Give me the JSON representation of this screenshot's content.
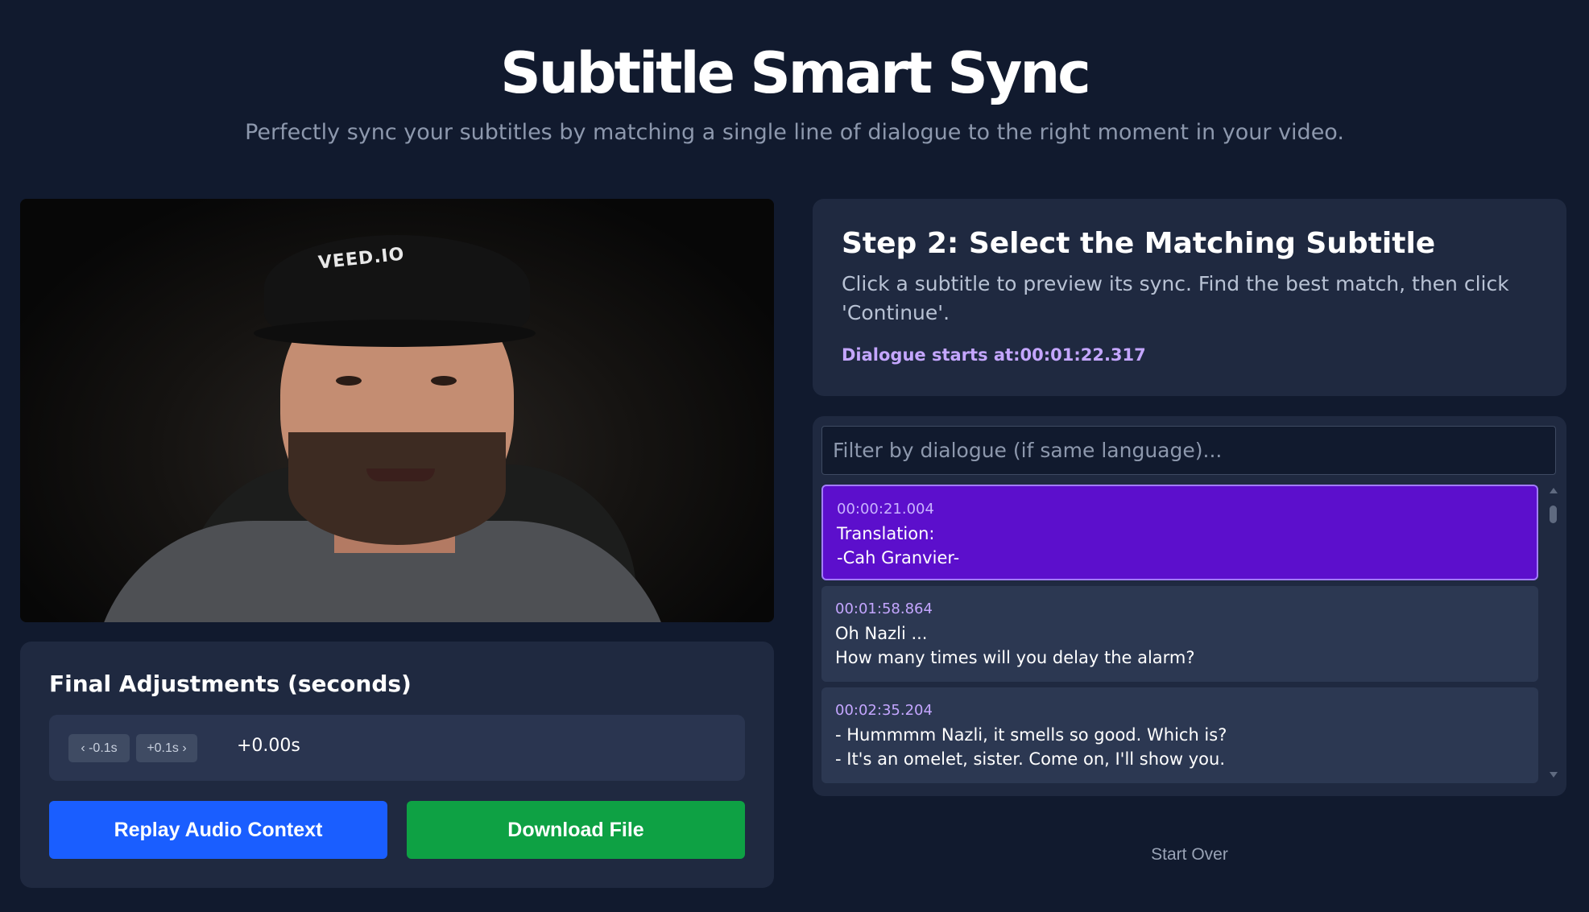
{
  "header": {
    "title": "Subtitle Smart Sync",
    "subtitle": "Perfectly sync your subtitles by matching a single line of dialogue to the right moment in your video."
  },
  "video": {
    "cap_logo": "VEED.IO"
  },
  "adjustments": {
    "title": "Final Adjustments (seconds)",
    "minus_label": "‹ -0.1s",
    "plus_label": "+0.1s ›",
    "offset_value": "+0.00s",
    "replay_label": "Replay Audio Context",
    "download_label": "Download File"
  },
  "step": {
    "title": "Step 2: Select the Matching Subtitle",
    "description": "Click a subtitle to preview its sync. Find the best match, then click 'Continue'.",
    "dialogue_start": "Dialogue starts at:00:01:22.317"
  },
  "filter": {
    "placeholder": "Filter by dialogue (if same language)..."
  },
  "subtitles": [
    {
      "time": "00:00:21.004",
      "line1": "Translation:",
      "line2": "-Cah Granvier-",
      "active": true
    },
    {
      "time": "00:01:58.864",
      "line1": "Oh Nazli ...",
      "line2": "How many times will you delay the alarm?",
      "active": false
    },
    {
      "time": "00:02:35.204",
      "line1": "- Hummmm Nazli, it smells so good. Which is?",
      "line2": "- It's an omelet, sister. Come on, I'll show you.",
      "active": false
    }
  ],
  "footer": {
    "start_over": "Start Over"
  },
  "colors": {
    "background": "#111a2e",
    "card": "#1f2940",
    "accent_purple": "#5c0fcc",
    "replay_blue": "#1a5eff",
    "download_green": "#0ea144",
    "time_lilac": "#c4a6ff"
  }
}
